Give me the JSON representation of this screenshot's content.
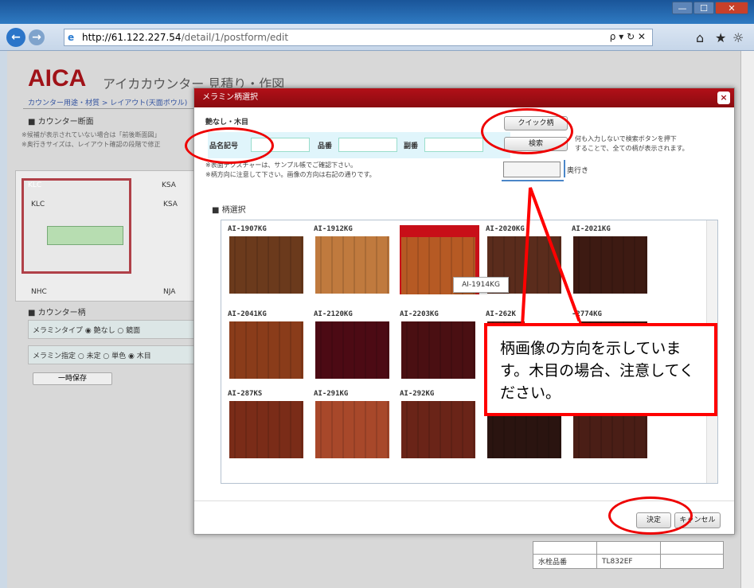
{
  "browser": {
    "url_host": "http://61.122.227.54",
    "url_path": "/detail/1/postform/edit",
    "url_controls": "ρ ▾ ↻ ✕",
    "win_min": "—",
    "win_max": "☐",
    "win_close": "✕",
    "back": "←",
    "forward": "→",
    "home_icon": "⌂",
    "star_icon": "★",
    "gear_icon": "☼"
  },
  "background_page": {
    "logo": "AICA",
    "title": "アイカカウンター 見積り・作図",
    "breadcrumb": "カウンター用途・材質 > レイアウト(天面ボウル)",
    "section1": "■ カウンター断面",
    "note1": "※候補が表示されていない場合は「前後断面図」",
    "note2": "※奥行きサイズは、レイアウト確認の段階で修正",
    "cells": [
      "KLC",
      "KSA",
      "KLC",
      "KSA",
      "NHC",
      "NJA"
    ],
    "section2": "■ カウンター柄",
    "row1": "メラミンタイプ ◉ 艶なし ○ 鏡面",
    "row2": "メラミン指定 ○ 未定 ○ 単色 ◉ 木目",
    "save_button": "一時保存",
    "table_row_label": "水栓品番",
    "table_row_value": "TL832EF"
  },
  "modal": {
    "title": "メラミン柄選択",
    "close": "×",
    "section_search": "艶なし・木目",
    "label_name": "品名記号",
    "label_number": "品番",
    "label_alias": "副番",
    "quick_button": "クイック柄",
    "search_button": "検索",
    "search_hint1": "何も入力しないで検索ボタンを押下",
    "search_hint2": "することで、全ての柄が表示されます。",
    "note1": "※表面テクスチャーは、サンプル帳でご確認下さい。",
    "note2": "※柄方向に注意して下さい。画像の方向は右記の通りです。",
    "depth_label": "奥行き",
    "section_pattern": "■ 柄選択",
    "tooltip": "AI-1914KG",
    "ok_button": "決定",
    "cancel_button": "キャンセル",
    "tiles": [
      {
        "label": "AI-1907KG",
        "color": "#6b3a1c"
      },
      {
        "label": "AI-1912KG",
        "color": "#c07a3e"
      },
      {
        "label": "AI-1914KG",
        "color": "#b65a24"
      },
      {
        "label": "AI-2020KG",
        "color": "#5a2c1c"
      },
      {
        "label": "AI-2021KG",
        "color": "#3d1a12"
      },
      {
        "label": "AI-2041KG",
        "color": "#8a3c1a"
      },
      {
        "label": "AI-2120KG",
        "color": "#4c0a14"
      },
      {
        "label": "AI-2203KG",
        "color": "#4a0f12"
      },
      {
        "label": "AI-262K",
        "color": "#5a1a14"
      },
      {
        "label": "-2774KG",
        "color": "#3a1810"
      },
      {
        "label": "AI-287KS",
        "color": "#7a2c18"
      },
      {
        "label": "AI-291KG",
        "color": "#a8482a"
      },
      {
        "label": "AI-292KG",
        "color": "#6a2418"
      },
      {
        "label": "",
        "color": "#2a1410"
      },
      {
        "label": "",
        "color": "#4a1e16"
      }
    ]
  },
  "callout": {
    "text": "柄画像の方向を示しています。木目の場合、注意してください。"
  },
  "colors": {
    "accent": "#a01218",
    "annotation": "#ff0000"
  }
}
